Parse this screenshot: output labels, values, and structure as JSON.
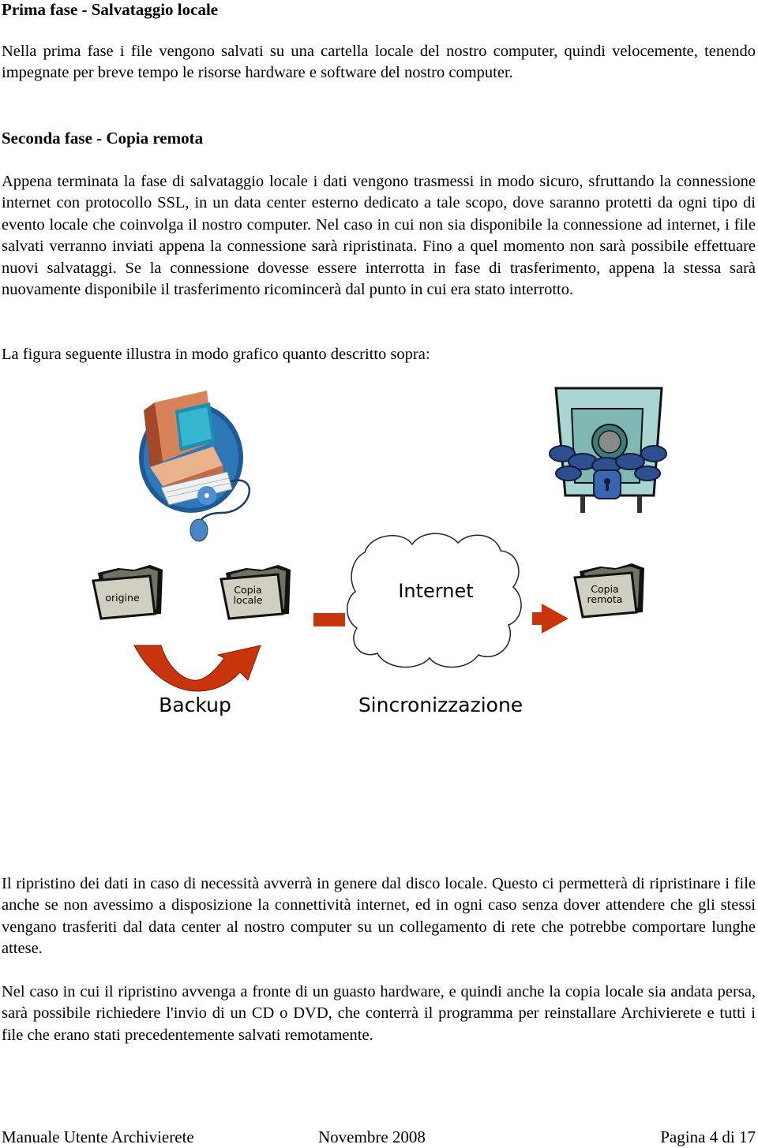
{
  "sections": [
    {
      "heading": "Prima fase - Salvataggio locale",
      "paragraphs": [
        "Nella prima fase i file vengono salvati su una cartella locale del nostro computer, quindi velocemente, tenendo impegnate per breve tempo le risorse hardware e software del nostro computer."
      ]
    },
    {
      "heading": "Seconda fase - Copia remota",
      "paragraphs": [
        "Appena terminata la fase di salvataggio locale i dati vengono trasmessi in modo sicuro, sfruttando la connessione internet con protocollo SSL, in un data center esterno dedicato a tale scopo, dove saranno protetti da ogni tipo di evento locale che coinvolga il nostro computer. Nel caso in cui non sia disponibile la connessione ad internet, i file salvati verranno inviati appena la connessione sarà ripristinata. Fino a quel momento non sarà possibile effettuare nuovi salvataggi. Se la connessione dovesse essere interrotta in fase di trasferimento, appena la stessa sarà nuovamente disponibile il trasferimento ricomincerà dal punto in cui era stato interrotto.",
        "La figura seguente illustra in modo grafico quanto descritto sopra:"
      ]
    }
  ],
  "figure": {
    "folders": {
      "origin": "origine",
      "local_copy_line1": "Copia",
      "local_copy_line2": "locale",
      "remote_copy_line1": "Copia",
      "remote_copy_line2": "remota"
    },
    "cloud_label": "Internet",
    "backup_label": "Backup",
    "sync_label": "Sincronizzazione",
    "icons": [
      "computer-icon",
      "safe-chained-icon",
      "folder-icon",
      "cloud-icon",
      "curved-arrow-icon",
      "arrow-right-icon"
    ],
    "colors": {
      "arrow": "#c8340c",
      "folder": "#c9cab8",
      "safe": "#a9d6d2",
      "chain": "#2e4f8f"
    }
  },
  "after_figure": [
    "Il ripristino dei dati in caso di necessità avverrà in genere dal disco locale. Questo ci permetterà di ripristinare i file anche se non avessimo a disposizione la connettività internet, ed in ogni caso senza dover attendere che gli stessi vengano trasferiti dal data center al nostro computer su un collegamento di rete che potrebbe comportare lunghe attese.",
    "Nel caso in cui il ripristino avvenga a fronte di un guasto hardware, e quindi anche la copia locale sia andata persa, sarà possibile richiedere l'invio di un CD o DVD, che conterrà il programma per reinstallare Archivierete e tutti i file che erano stati precedentemente salvati remotamente."
  ],
  "footer": {
    "left": "Manuale Utente Archivierete",
    "center": "Novembre 2008",
    "right": "Pagina 4 di 17"
  }
}
